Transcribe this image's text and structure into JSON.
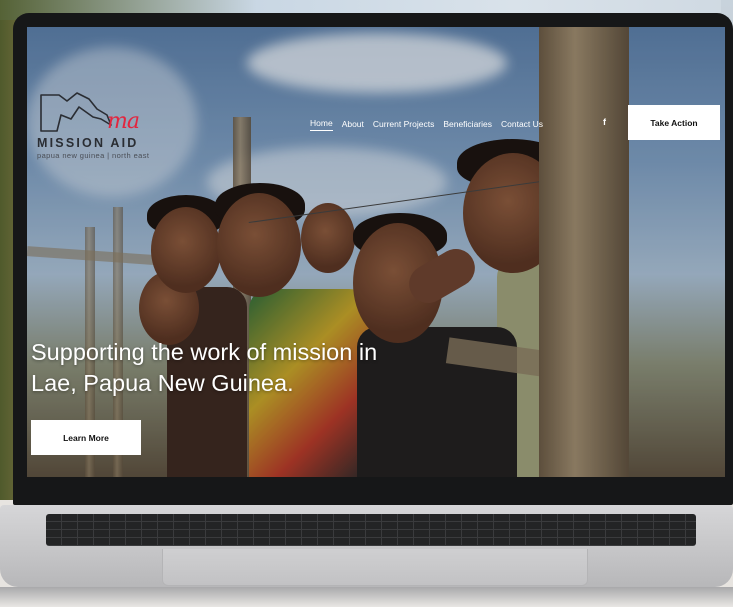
{
  "site": {
    "logo": {
      "monogram": "ma",
      "name": "MISSION AID",
      "tagline": "papua new guinea | north east"
    },
    "nav": {
      "items": [
        {
          "label": "Home",
          "active": true
        },
        {
          "label": "About",
          "active": false
        },
        {
          "label": "Current Projects",
          "active": false
        },
        {
          "label": "Beneficiaries",
          "active": false
        },
        {
          "label": "Contact Us",
          "active": false
        }
      ],
      "social_icon": "facebook-icon",
      "social_glyph": "f",
      "cta_label": "Take Action"
    },
    "hero": {
      "title_line1": "Supporting the work of mission in",
      "title_line2": "Lae, Papua New Guinea.",
      "button_label": "Learn More"
    }
  },
  "colors": {
    "brand_red": "#e2263f",
    "logo_text": "#2a2d33",
    "laptop_bezel": "#161718"
  }
}
